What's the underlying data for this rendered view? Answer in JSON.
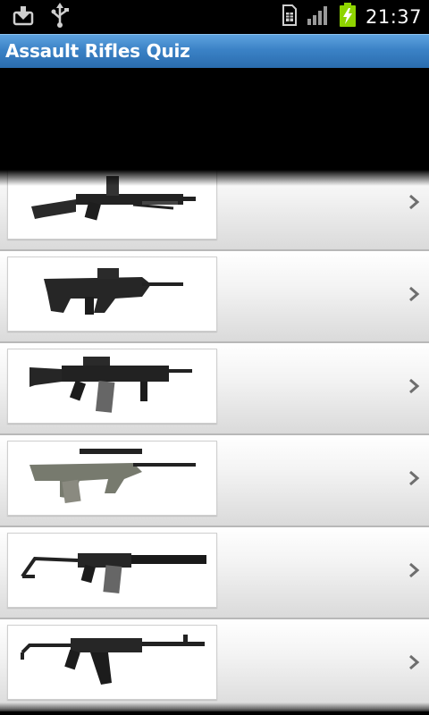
{
  "status_bar": {
    "time": "21:37",
    "icons": [
      "download-icon",
      "usb-icon",
      "sim-card-icon",
      "signal-icon",
      "battery-charging-icon"
    ]
  },
  "app": {
    "title": "Assault Rifles Quiz"
  },
  "list": {
    "items": [
      {
        "image": "machine-gun-image",
        "chevron": "chevron-right-icon"
      },
      {
        "image": "bullpup-rifle-image",
        "chevron": "chevron-right-icon"
      },
      {
        "image": "carbine-rifle-image",
        "chevron": "chevron-right-icon"
      },
      {
        "image": "scoped-bullpup-rifle-image",
        "chevron": "chevron-right-icon"
      },
      {
        "image": "suppressed-rifle-image",
        "chevron": "chevron-right-icon"
      },
      {
        "image": "kalashnikov-rifle-image",
        "chevron": "chevron-right-icon"
      }
    ]
  },
  "colors": {
    "title_bar": "#3b82c6",
    "battery": "#8fd400"
  }
}
